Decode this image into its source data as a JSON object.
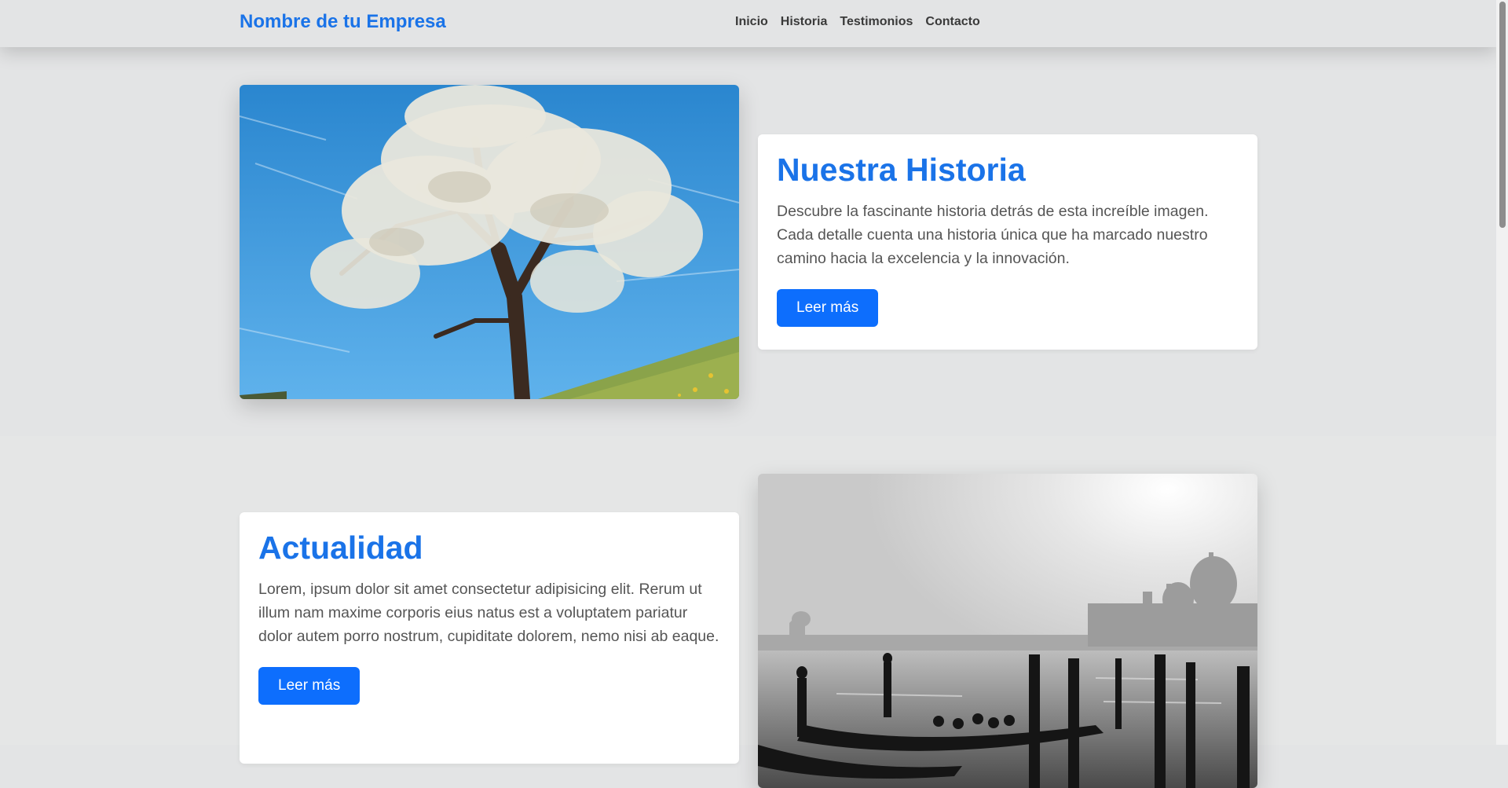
{
  "header": {
    "brand": "Nombre de tu Empresa",
    "nav": [
      "Inicio",
      "Historia",
      "Testimonios",
      "Contacto"
    ]
  },
  "historia": {
    "title": "Nuestra Historia",
    "text": "Descubre la fascinante historia detrás de esta increíble imagen. Cada detalle cuenta una historia única que ha marcado nuestro camino hacia la excelencia y la innovación.",
    "button": "Leer más"
  },
  "actualidad": {
    "title": "Actualidad",
    "text": "Lorem, ipsum dolor sit amet consectetur adipisicing elit. Rerum ut illum nam maxime corporis eius natus est a voluptatem pariatur dolor autem porro nostrum, cupiditate dolorem, nemo nisi ab eaque.",
    "button": "Leer más"
  },
  "colors": {
    "accent": "#1a73e8",
    "button": "#0d6efd",
    "background": "#e3e4e5"
  }
}
